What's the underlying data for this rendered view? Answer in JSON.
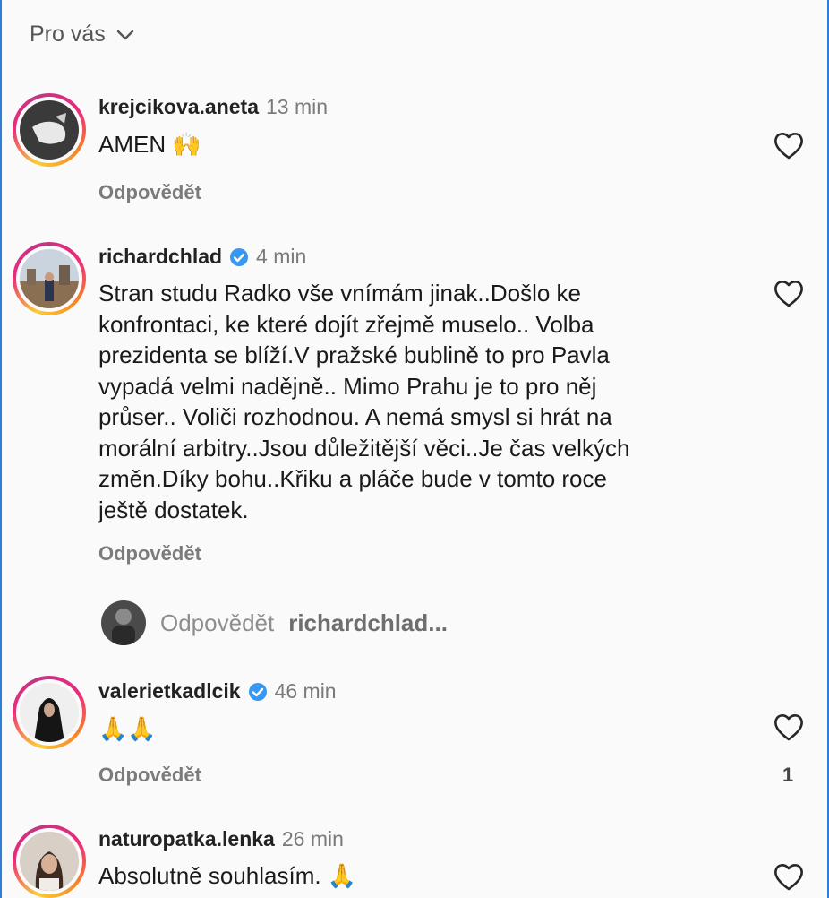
{
  "header": {
    "label": "Pro vás",
    "dropdown_icon": "chevron-down-icon"
  },
  "comments": [
    {
      "username": "krejcikova.aneta",
      "verified": false,
      "time": "13 min",
      "text": "AMEN",
      "emoji": "🙌",
      "reply_label": "Odpovědět",
      "like_count": ""
    },
    {
      "username": "richardchlad",
      "verified": true,
      "time": "4 min",
      "text_lines": [
        "Stran studu Radko vše vnímám jinak..Došlo ke",
        "konfrontaci, ke které dojít zřejmě muselo.. Volba",
        "prezidenta se blíží.V pražské bublině to pro Pavla",
        "vypadá velmi nadějně.. Mimo Prahu je to pro něj",
        "průser.. Voliči rozhodnou. A nemá smysl si hrát na",
        "morální arbitry..Jsou důležitější věci..Je čas velkých",
        "změn.Díky bohu..Křiku a pláče bude v tomto roce",
        "ještě dostatek."
      ],
      "reply_label": "Odpovědět",
      "like_count": ""
    },
    {
      "username": "valerietkadlcik",
      "verified": true,
      "time": "46 min",
      "emoji": "🙏🙏",
      "reply_label": "Odpovědět",
      "like_count": "1"
    },
    {
      "username": "naturopatka.lenka",
      "verified": false,
      "time": "26 min",
      "text": "Absolutně souhlasím.",
      "emoji": "🙏",
      "like_count": ""
    }
  ],
  "reply_input": {
    "placeholder": "Odpovědět",
    "target_user": "richardchlad..."
  },
  "colors": {
    "background": "#fafafa",
    "verified": "#3897f0",
    "muted": "#7b7b7b"
  }
}
